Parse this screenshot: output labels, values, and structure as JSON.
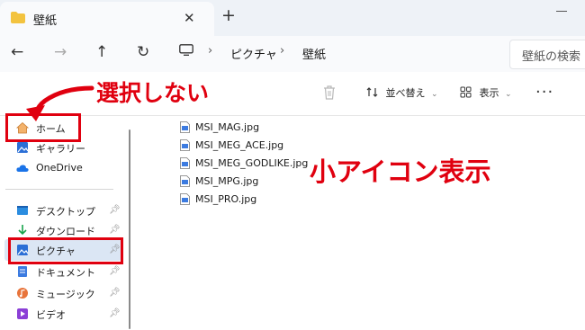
{
  "window": {
    "tab_title": "壁紙",
    "tab_close": "✕",
    "new_tab": "+"
  },
  "toolbar": {
    "back": "←",
    "forward": "→",
    "up": "↑",
    "refresh": "↻",
    "breadcrumbs": [
      "ピクチャ",
      "壁紙"
    ],
    "separator": "›",
    "search_placeholder": "壁紙の検索"
  },
  "commands": {
    "sort_label": "並べ替え",
    "view_label": "表示",
    "more": "···"
  },
  "sidebar": {
    "top_items": [
      {
        "label": "ホーム",
        "icon": "home-icon"
      },
      {
        "label": "ギャラリー",
        "icon": "gallery-icon"
      },
      {
        "label": "OneDrive",
        "icon": "cloud-icon"
      }
    ],
    "quick_access": [
      {
        "label": "デスクトップ",
        "icon": "desktop-icon",
        "pinned": true
      },
      {
        "label": "ダウンロード",
        "icon": "download-icon",
        "pinned": true
      },
      {
        "label": "ピクチャ",
        "icon": "pictures-icon",
        "pinned": true,
        "selected": true
      },
      {
        "label": "ドキュメント",
        "icon": "documents-icon",
        "pinned": true
      },
      {
        "label": "ミュージック",
        "icon": "music-icon",
        "pinned": true
      },
      {
        "label": "ビデオ",
        "icon": "video-icon",
        "pinned": true
      }
    ]
  },
  "files": [
    "MSI_MAG.jpg",
    "MSI_MEG_ACE.jpg",
    "MSI_MEG_GODLIKE.jpg",
    "MSI_MPG.jpg",
    "MSI_PRO.jpg"
  ],
  "annotations": {
    "dont_select": "選択しない",
    "small_icon_view": "小アイコン表示"
  },
  "colors": {
    "annotation_red": "#e0000f",
    "selected_bg": "#dbe6f4",
    "folder_yellow": "#f3c33f"
  }
}
